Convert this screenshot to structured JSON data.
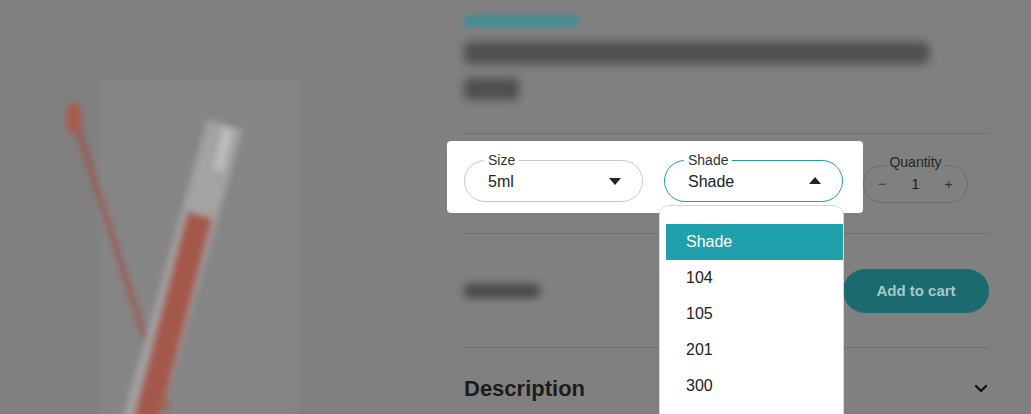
{
  "variant_picker": {
    "fields": [
      {
        "label": "Size",
        "value": "5ml",
        "expanded": false
      },
      {
        "label": "Shade",
        "value": "Shade",
        "expanded": true
      }
    ]
  },
  "shade_menu": {
    "options": [
      {
        "label": "Shade",
        "selected": true
      },
      {
        "label": "104",
        "selected": false
      },
      {
        "label": "105",
        "selected": false
      },
      {
        "label": "201",
        "selected": false
      },
      {
        "label": "300",
        "selected": false
      }
    ]
  },
  "quantity": {
    "label": "Quantity",
    "decrement": "−",
    "value": "1",
    "increment": "+"
  },
  "add_to_cart": "Add to cart",
  "description": {
    "title": "Description",
    "expanded": false
  }
}
